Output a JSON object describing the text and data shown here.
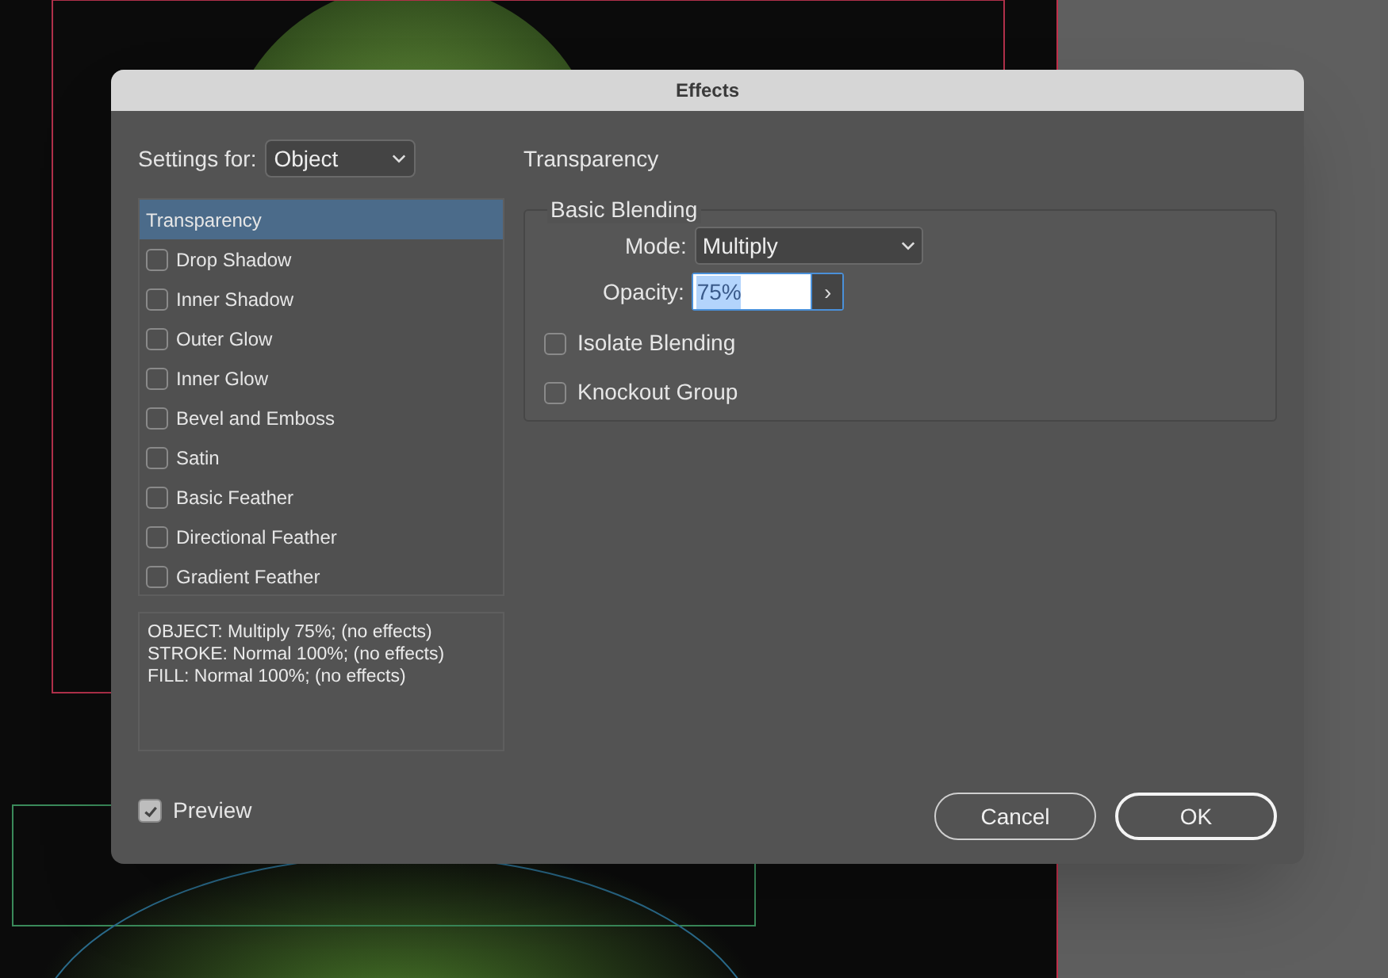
{
  "dialog": {
    "title": "Effects"
  },
  "settings_for": {
    "label": "Settings for:",
    "value": "Object"
  },
  "effects": [
    {
      "kind": "header",
      "label": "Transparency",
      "selected": true
    },
    {
      "kind": "checkbox",
      "label": "Drop Shadow",
      "checked": false,
      "selected": false
    },
    {
      "kind": "checkbox",
      "label": "Inner Shadow",
      "checked": false,
      "selected": false
    },
    {
      "kind": "checkbox",
      "label": "Outer Glow",
      "checked": false,
      "selected": false
    },
    {
      "kind": "checkbox",
      "label": "Inner Glow",
      "checked": false,
      "selected": false
    },
    {
      "kind": "checkbox",
      "label": "Bevel and Emboss",
      "checked": false,
      "selected": false
    },
    {
      "kind": "checkbox",
      "label": "Satin",
      "checked": false,
      "selected": false
    },
    {
      "kind": "checkbox",
      "label": "Basic Feather",
      "checked": false,
      "selected": false
    },
    {
      "kind": "checkbox",
      "label": "Directional Feather",
      "checked": false,
      "selected": false
    },
    {
      "kind": "checkbox",
      "label": "Gradient Feather",
      "checked": false,
      "selected": false
    }
  ],
  "summary": [
    "OBJECT: Multiply 75%; (no effects)",
    "STROKE: Normal 100%; (no effects)",
    "FILL: Normal 100%; (no effects)"
  ],
  "preview": {
    "label": "Preview",
    "checked": true
  },
  "panel": {
    "title": "Transparency",
    "group": "Basic Blending",
    "mode": {
      "label": "Mode:",
      "value": "Multiply"
    },
    "opacity": {
      "label": "Opacity:",
      "value": "75%",
      "arrow": "›"
    },
    "options": [
      {
        "label": "Isolate Blending",
        "checked": false
      },
      {
        "label": "Knockout Group",
        "checked": false
      }
    ]
  },
  "buttons": [
    {
      "label": "Cancel",
      "default": false
    },
    {
      "label": "OK",
      "default": true
    }
  ]
}
